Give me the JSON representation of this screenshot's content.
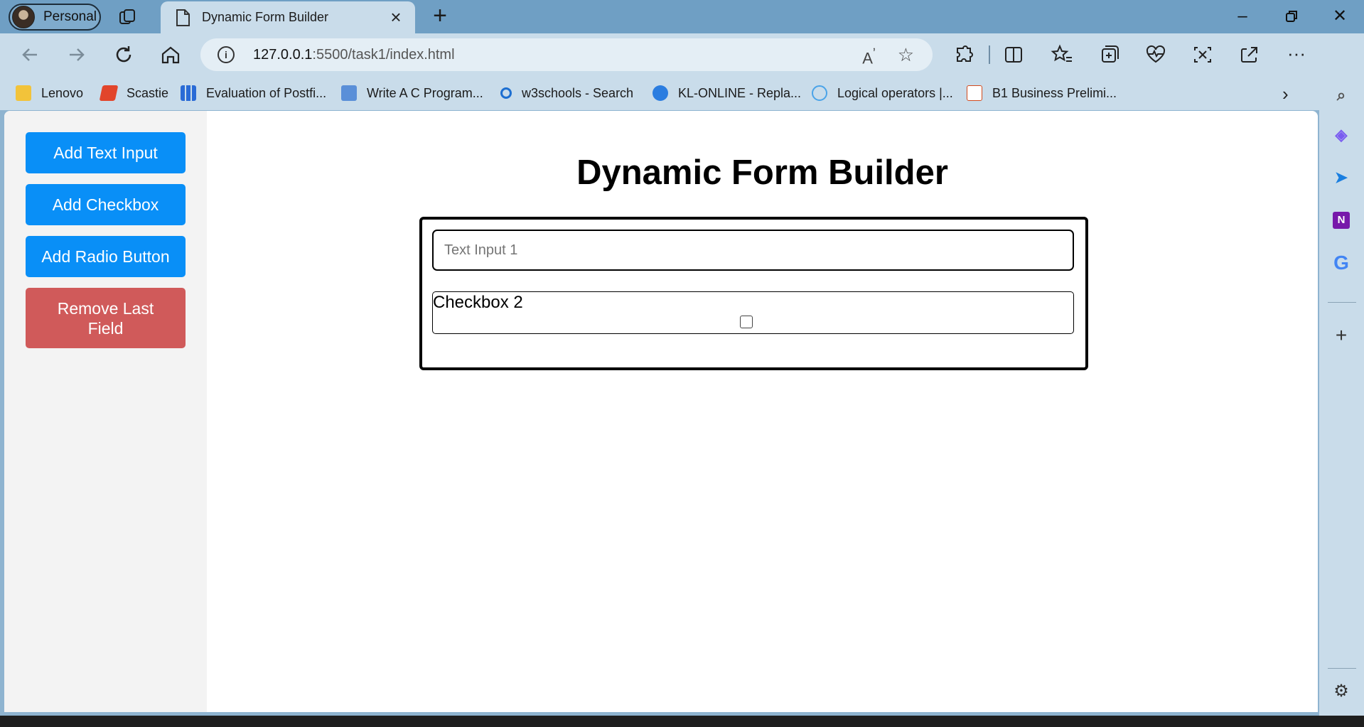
{
  "browser": {
    "profile_label": "Personal",
    "tab_title": "Dynamic Form Builder",
    "url_host": "127.0.0.1",
    "url_rest": ":5500/task1/index.html",
    "bookmarks": [
      {
        "label": "Lenovo",
        "icon": "folder-icon",
        "color": "#f2c33a"
      },
      {
        "label": "Scastie",
        "icon": "scastie-icon",
        "color": "#e2452b"
      },
      {
        "label": "Evaluation of Postfi...",
        "icon": "grid-icon",
        "color": "#2a6bd6"
      },
      {
        "label": "Write A C Program...",
        "icon": "code-icon",
        "color": "#5a8fd8"
      },
      {
        "label": "w3schools - Search",
        "icon": "search-icon",
        "color": "#1d6fd1"
      },
      {
        "label": "KL-ONLINE - Repla...",
        "icon": "kl-icon",
        "color": "#2b7de0"
      },
      {
        "label": "Logical operators |...",
        "icon": "react-icon",
        "color": "#4aa3e8"
      },
      {
        "label": "B1 Business Prelimi...",
        "icon": "b1-icon",
        "color": "#d14a1e"
      }
    ]
  },
  "sidebar": {
    "add_text_label": "Add Text Input",
    "add_checkbox_label": "Add Checkbox",
    "add_radio_label": "Add Radio Button",
    "remove_label": "Remove Last Field"
  },
  "main": {
    "title": "Dynamic Form Builder",
    "text_input_placeholder": "Text Input 1",
    "checkbox_label": "Checkbox 2",
    "checkbox_checked": false
  },
  "colors": {
    "primary_button": "#098ff7",
    "danger_button": "#d05a5a",
    "sidebar_bg": "#f3f3f3"
  }
}
